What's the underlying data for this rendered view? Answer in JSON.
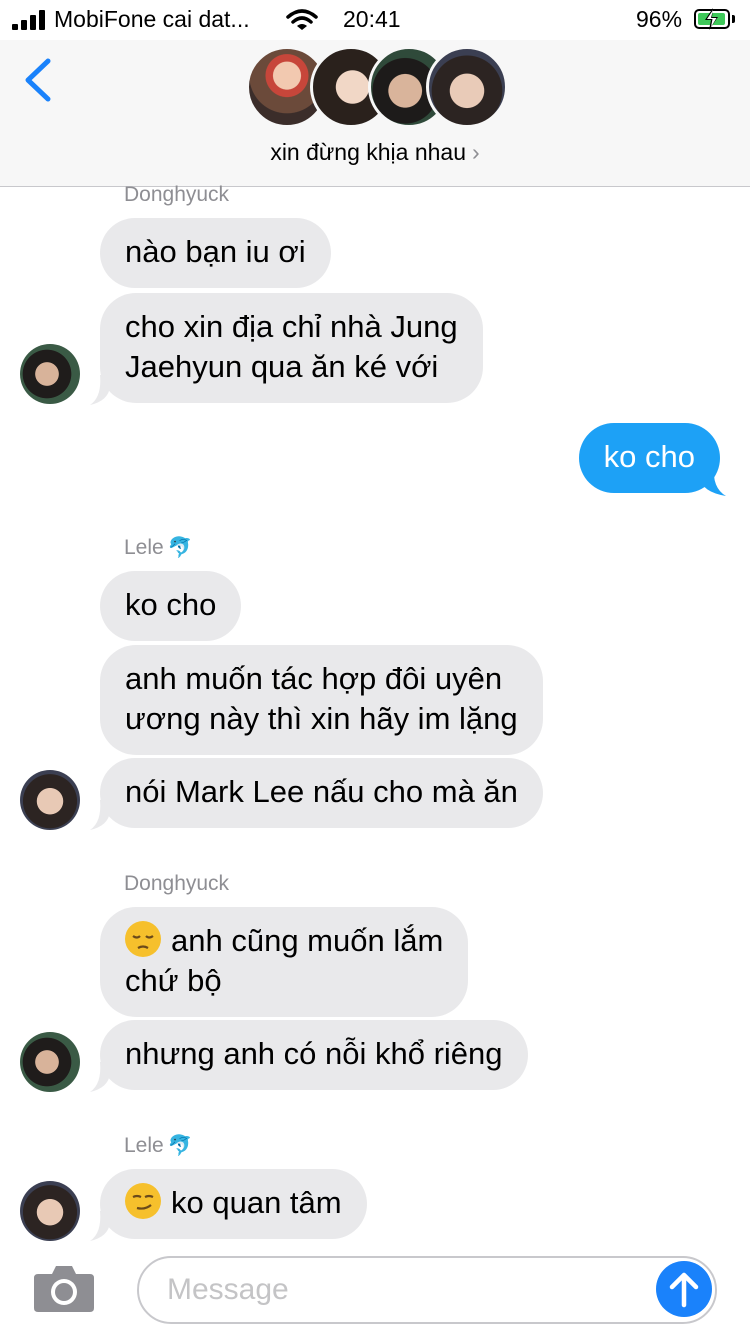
{
  "status_bar": {
    "carrier": "MobiFone cai dat...",
    "time": "20:41",
    "battery": "96%",
    "battery_level": 0.96
  },
  "header": {
    "group_name": "xin đừng khịa nhau",
    "chevron": "›",
    "avatar_count": 4
  },
  "messages": [
    {
      "sender": "Donghyuck"
    },
    {
      "text": "nào bạn iu ơi"
    },
    {
      "text": "cho xin địa chỉ nhà Jung\nJaehyun qua ăn ké với"
    },
    {
      "text": "ko cho"
    },
    {
      "sender": "Lele",
      "sender_emoji": "🐬"
    },
    {
      "text": "ko cho"
    },
    {
      "text": "anh muốn tác hợp đôi uyên\nương này thì xin hãy im lặng"
    },
    {
      "text": "nói Mark Lee nấu cho mà ăn"
    },
    {
      "sender": "Donghyuck"
    },
    {
      "text": "anh cũng muốn lắm\nchứ bộ",
      "emoji": "pensive-face-emoji"
    },
    {
      "text": "nhưng anh có nỗi khổ riêng"
    },
    {
      "sender": "Lele",
      "sender_emoji": "🐬"
    },
    {
      "text": "ko quan tâm",
      "emoji": "smirking-face-emoji"
    }
  ],
  "input": {
    "placeholder": "Message"
  },
  "colors": {
    "incoming_bubble": "#e9e9eb",
    "outgoing_bubble": "#1da1f6",
    "send_button": "#1a82fb",
    "back_chevron": "#1a82fb"
  }
}
